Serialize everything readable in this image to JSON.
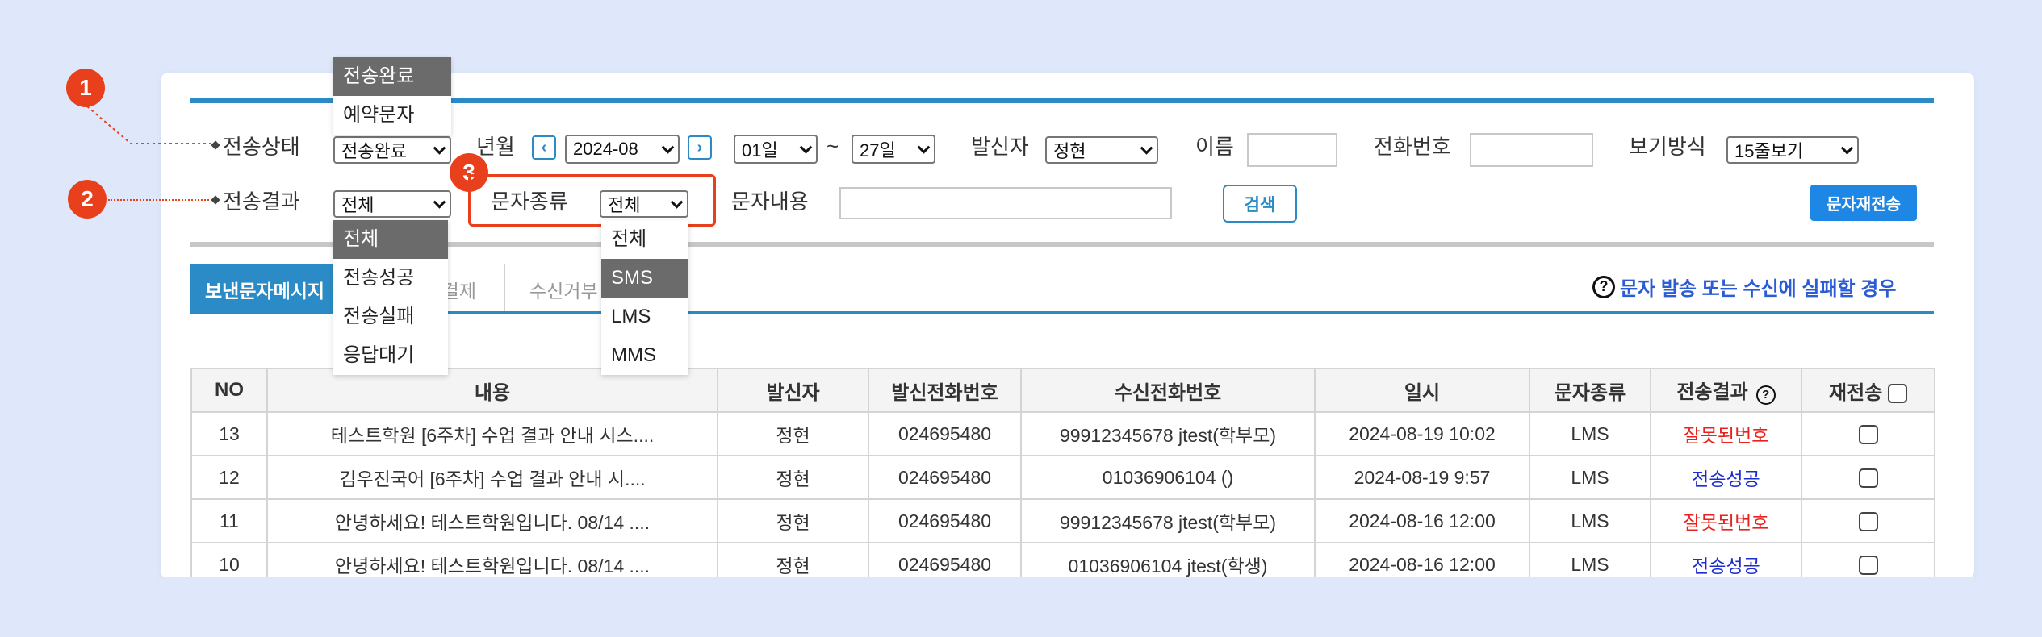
{
  "filters": {
    "send_status_label": "전송상태",
    "send_status_value": "전송완료",
    "month_label": "년월",
    "month_value": "2024-08",
    "prev_icon": "‹",
    "next_icon": "›",
    "day_from": "01일",
    "tilde": "~",
    "day_to": "27일",
    "sender_label": "발신자",
    "sender_value": "정현",
    "name_label": "이름",
    "name_value": "",
    "phone_label": "전화번호",
    "phone_value": "",
    "view_label": "보기방식",
    "view_value": "15줄보기",
    "result_label": "전송결과",
    "result_value": "전체",
    "type_label": "문자종류",
    "type_value": "전체",
    "content_label": "문자내용",
    "content_value": "",
    "search_button": "검색",
    "resend_button": "문자재전송"
  },
  "dropdowns": {
    "send_status": [
      "전송완료",
      "예약문자"
    ],
    "result": [
      "전체",
      "전송성공",
      "전송실패",
      "응답대기"
    ],
    "type": [
      "전체",
      "SMS",
      "LMS",
      "MMS"
    ]
  },
  "annotations": [
    "1",
    "2",
    "3"
  ],
  "tabs": [
    "보낸문자메시지",
    "결제",
    "수신거부"
  ],
  "help_link": "문자 발송 또는 수신에 실패할 경우",
  "help_icon": "?",
  "table": {
    "headers": [
      "NO",
      "내용",
      "발신자",
      "발신전화번호",
      "수신전화번호",
      "일시",
      "문자종류",
      "전송결과",
      "재전송"
    ],
    "rows": [
      [
        "13",
        "테스트학원 [6주차] 수업 결과 안내 시스....",
        "정현",
        "024695480",
        "99912345678 jtest(학부모)",
        "2024-08-19 10:02",
        "LMS",
        "잘못된번호"
      ],
      [
        "12",
        "김우진국어 [6주차] 수업 결과 안내 시....",
        "정현",
        "024695480",
        "01036906104 ()",
        "2024-08-19 9:57",
        "LMS",
        "전송성공"
      ],
      [
        "11",
        "안녕하세요! 테스트학원입니다. 08/14 ....",
        "정현",
        "024695480",
        "99912345678 jtest(학부모)",
        "2024-08-16 12:00",
        "LMS",
        "잘못된번호"
      ],
      [
        "10",
        "안녕하세요! 테스트학원입니다. 08/14 ....",
        "정현",
        "024695480",
        "01036906104 jtest(학생)",
        "2024-08-16 12:00",
        "LMS",
        "전송성공"
      ]
    ]
  },
  "colors": {
    "accent": "#2b8bc6",
    "badge": "#e8401c",
    "error": "#e8221c",
    "success": "#1c2ccf",
    "resend_button": "#1e87e5"
  }
}
